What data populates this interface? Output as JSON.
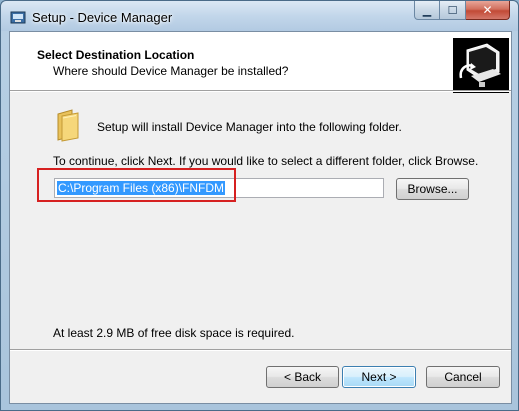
{
  "window": {
    "title": "Setup - Device Manager",
    "close_glyph": "✕",
    "minimize_glyph": "▁",
    "maximize_glyph": "☐"
  },
  "header": {
    "title": "Select Destination Location",
    "subtitle": "Where should Device Manager be installed?"
  },
  "body": {
    "install_text": "Setup will install Device Manager into the following folder.",
    "continue_text": "To continue, click Next. If you would like to select a different folder, click Browse.",
    "path_value": "C:\\Program Files (x86)\\FNFDM",
    "browse_label": "Browse...",
    "space_text": "At least 2.9 MB of free disk space is required."
  },
  "footer": {
    "back_label": "< Back",
    "next_label": "Next >",
    "cancel_label": "Cancel"
  },
  "colors": {
    "highlight_box": "#d62020",
    "selection": "#3399ff"
  },
  "icons": {
    "title": "setup-app-icon",
    "header": "installer-computer-icon",
    "folder": "folder-icon"
  }
}
